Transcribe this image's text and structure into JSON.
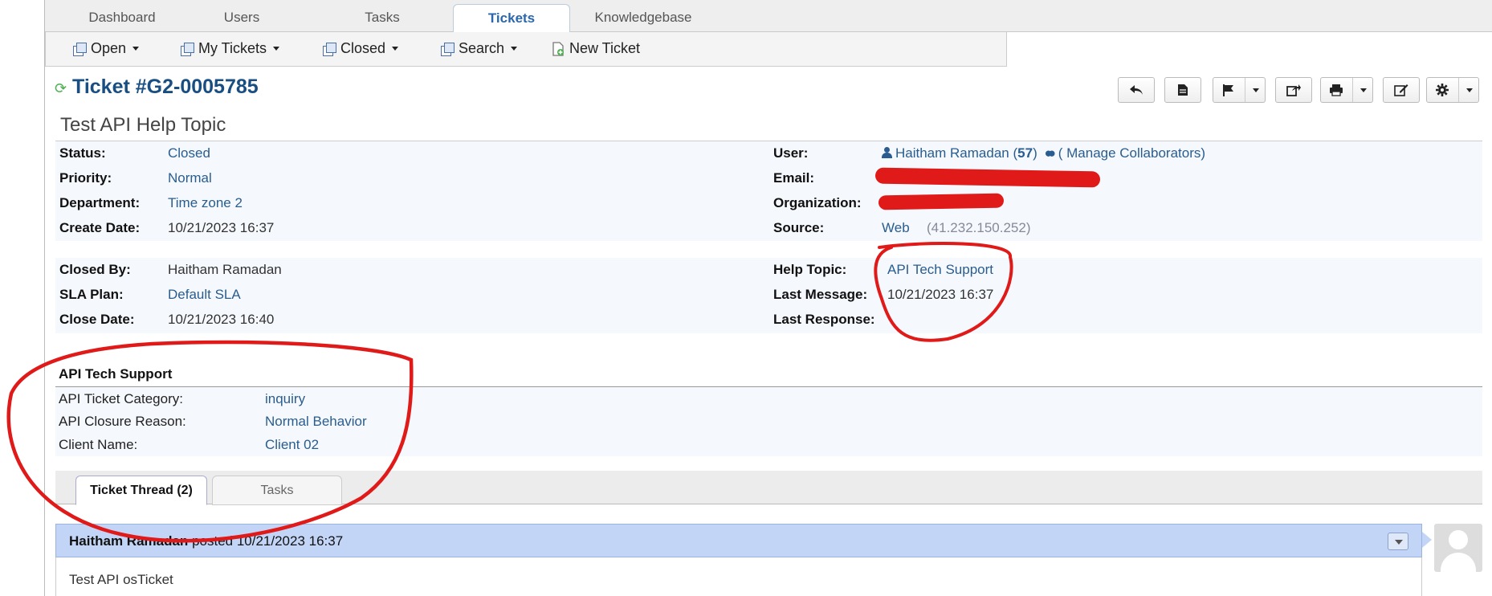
{
  "nav": {
    "tabs": [
      {
        "label": "Dashboard"
      },
      {
        "label": "Users"
      },
      {
        "label": "Tasks"
      },
      {
        "label": "Tickets"
      },
      {
        "label": "Knowledgebase"
      }
    ],
    "active_tab": "Tickets"
  },
  "subnav": {
    "items": [
      {
        "label": "Open"
      },
      {
        "label": "My Tickets"
      },
      {
        "label": "Closed"
      },
      {
        "label": "Search"
      },
      {
        "label": "New Ticket"
      }
    ]
  },
  "ticket": {
    "title": "Ticket #G2-0005785",
    "subject": "Test API Help Topic"
  },
  "info1": {
    "status_label": "Status:",
    "status": "Closed",
    "priority_label": "Priority:",
    "priority": "Normal",
    "department_label": "Department:",
    "department": "Time zone 2",
    "create_date_label": "Create Date:",
    "create_date": "10/21/2023 16:37",
    "user_label": "User:",
    "user_name": "Haitham Ramadan",
    "user_count": "57",
    "manage_collaborators": "( Manage Collaborators)",
    "email_label": "Email:",
    "organization_label": "Organization:",
    "source_label": "Source:",
    "source": "Web",
    "source_ip": "(41.232.150.252)"
  },
  "info2": {
    "closed_by_label": "Closed By:",
    "closed_by": "Haitham Ramadan",
    "sla_label": "SLA Plan:",
    "sla": "Default SLA",
    "close_date_label": "Close Date:",
    "close_date": "10/21/2023 16:40",
    "help_topic_label": "Help Topic:",
    "help_topic": "API Tech Support",
    "last_message_label": "Last Message:",
    "last_message": "10/21/2023 16:37",
    "last_response_label": "Last Response:"
  },
  "form": {
    "title": "API Tech Support",
    "fields": [
      {
        "label": "API Ticket Category:",
        "value": "inquiry"
      },
      {
        "label": "API Closure Reason:",
        "value": "Normal Behavior"
      },
      {
        "label": "Client Name:",
        "value": "Client 02"
      }
    ]
  },
  "thread_tabs": [
    {
      "label": "Ticket Thread (2)"
    },
    {
      "label": "Tasks"
    }
  ],
  "entry": {
    "author": "Haitham Ramadan",
    "posted": "posted 10/21/2023 16:37",
    "body": "Test API osTicket"
  },
  "colors": {
    "accent": "#184e81",
    "link": "#2a5d8f",
    "annotation": "#e01919",
    "thread_header": "#c3d5f6"
  }
}
